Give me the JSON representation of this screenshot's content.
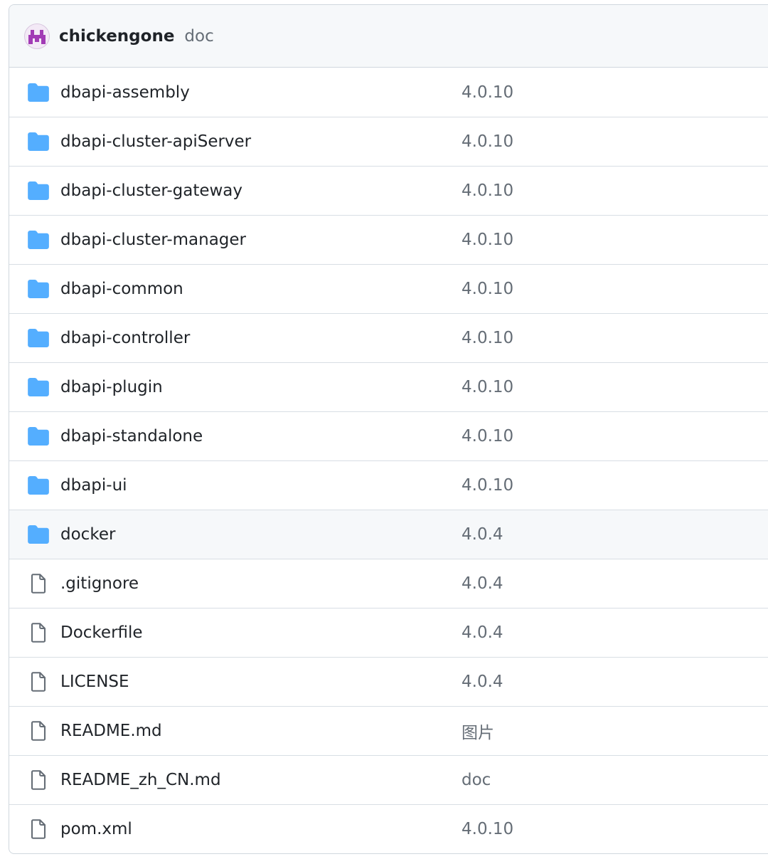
{
  "commit": {
    "author": "chickengone",
    "message": "doc"
  },
  "colors": {
    "folder": "#54aeff",
    "file_icon": "#656d76",
    "border": "#d0d7de",
    "header_bg": "#f6f8fa",
    "avatar_accent": "#a23bb5"
  },
  "files": [
    {
      "name": "dbapi-assembly",
      "message": "4.0.10",
      "type": "folder",
      "icon": "folder-icon"
    },
    {
      "name": "dbapi-cluster-apiServer",
      "message": "4.0.10",
      "type": "folder",
      "icon": "folder-icon"
    },
    {
      "name": "dbapi-cluster-gateway",
      "message": "4.0.10",
      "type": "folder",
      "icon": "folder-icon"
    },
    {
      "name": "dbapi-cluster-manager",
      "message": "4.0.10",
      "type": "folder",
      "icon": "folder-icon"
    },
    {
      "name": "dbapi-common",
      "message": "4.0.10",
      "type": "folder",
      "icon": "folder-icon"
    },
    {
      "name": "dbapi-controller",
      "message": "4.0.10",
      "type": "folder",
      "icon": "folder-icon"
    },
    {
      "name": "dbapi-plugin",
      "message": "4.0.10",
      "type": "folder",
      "icon": "folder-icon"
    },
    {
      "name": "dbapi-standalone",
      "message": "4.0.10",
      "type": "folder",
      "icon": "folder-icon"
    },
    {
      "name": "dbapi-ui",
      "message": "4.0.10",
      "type": "folder",
      "icon": "folder-icon"
    },
    {
      "name": "docker",
      "message": "4.0.4",
      "type": "folder",
      "icon": "folder-icon",
      "hovered": true
    },
    {
      "name": ".gitignore",
      "message": "4.0.4",
      "type": "file",
      "icon": "file-icon"
    },
    {
      "name": "Dockerfile",
      "message": "4.0.4",
      "type": "file",
      "icon": "file-icon"
    },
    {
      "name": "LICENSE",
      "message": "4.0.4",
      "type": "file",
      "icon": "file-icon"
    },
    {
      "name": "README.md",
      "message": "图片",
      "type": "file",
      "icon": "file-icon"
    },
    {
      "name": "README_zh_CN.md",
      "message": "doc",
      "type": "file",
      "icon": "file-icon"
    },
    {
      "name": "pom.xml",
      "message": "4.0.10",
      "type": "file",
      "icon": "file-icon"
    }
  ]
}
